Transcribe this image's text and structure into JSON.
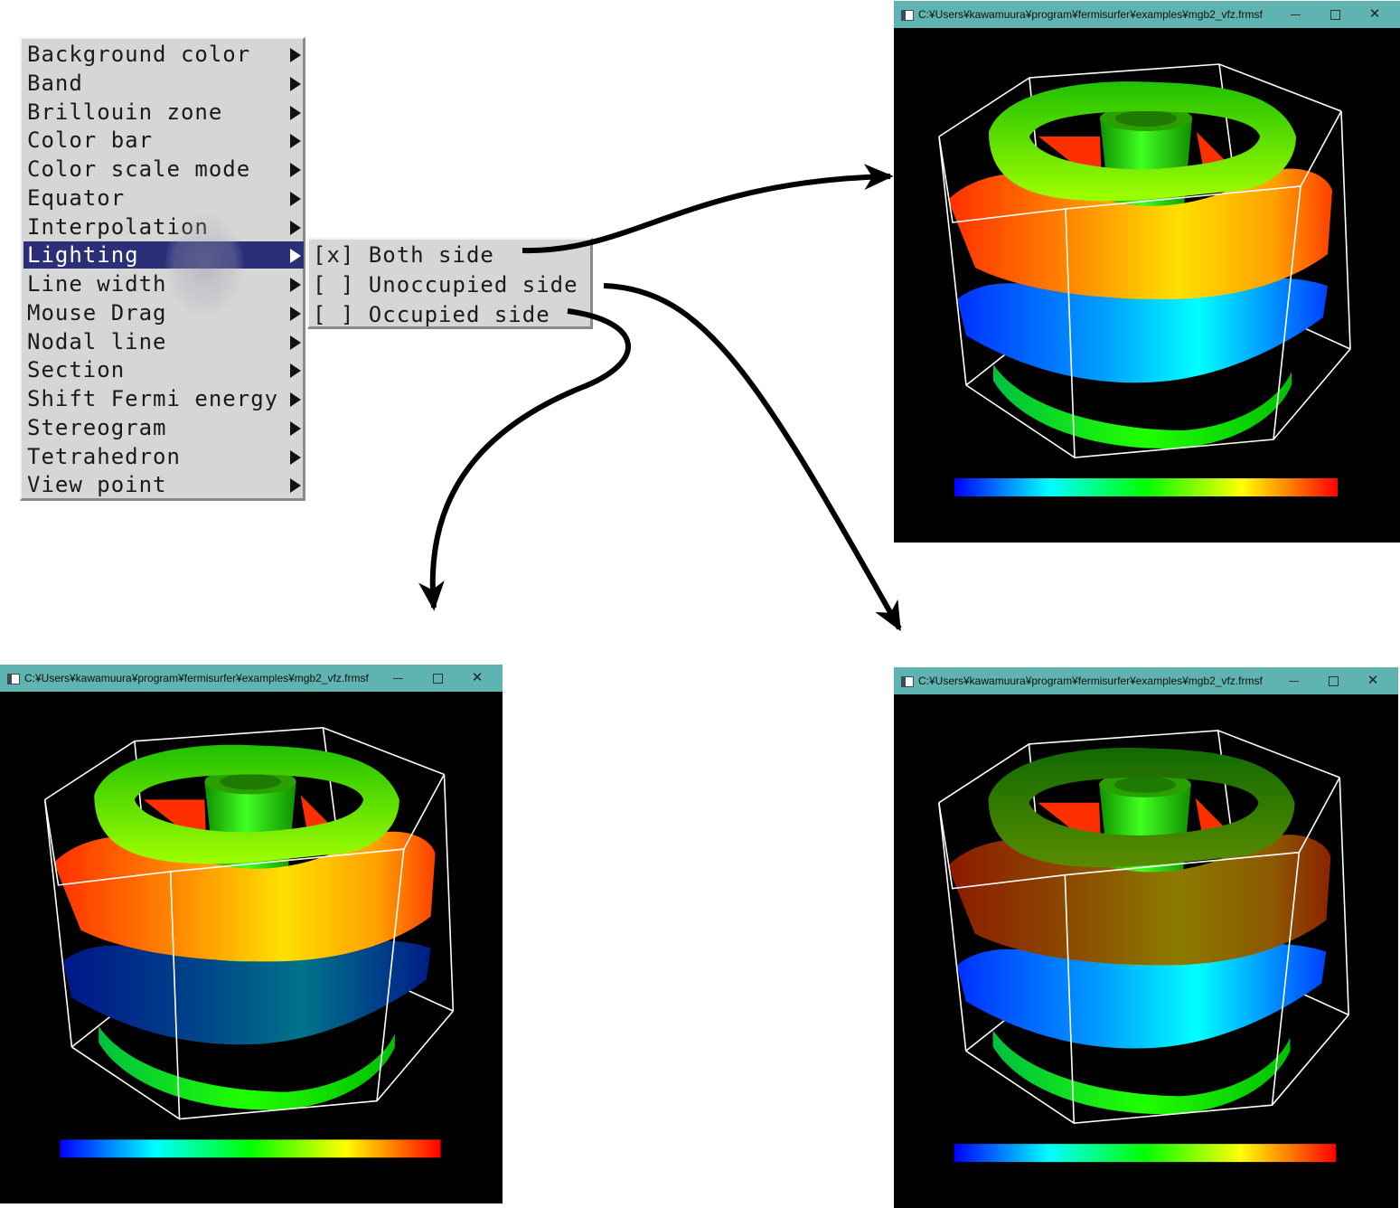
{
  "menu": {
    "items": [
      {
        "label": "Background color",
        "name": "menu-item-background-color"
      },
      {
        "label": "Band",
        "name": "menu-item-band"
      },
      {
        "label": "Brillouin zone",
        "name": "menu-item-brillouin-zone"
      },
      {
        "label": "Color bar",
        "name": "menu-item-color-bar"
      },
      {
        "label": "Color scale mode",
        "name": "menu-item-color-scale-mode"
      },
      {
        "label": "Equator",
        "name": "menu-item-equator"
      },
      {
        "label": "Interpolation",
        "name": "menu-item-interpolation"
      },
      {
        "label": "Lighting",
        "name": "menu-item-lighting",
        "active": true
      },
      {
        "label": "Line width",
        "name": "menu-item-line-width"
      },
      {
        "label": "Mouse Drag",
        "name": "menu-item-mouse-drag"
      },
      {
        "label": "Nodal line",
        "name": "menu-item-nodal-line"
      },
      {
        "label": "Section",
        "name": "menu-item-section"
      },
      {
        "label": "Shift Fermi energy",
        "name": "menu-item-shift-fermi-energy"
      },
      {
        "label": "Stereogram",
        "name": "menu-item-stereogram"
      },
      {
        "label": "Tetrahedron",
        "name": "menu-item-tetrahedron"
      },
      {
        "label": "View point",
        "name": "menu-item-view-point"
      }
    ]
  },
  "submenu": {
    "items": [
      {
        "label": "[x] Both side",
        "name": "submenu-item-both-side",
        "checked": true
      },
      {
        "label": "[ ] Unoccupied side",
        "name": "submenu-item-unoccupied-side",
        "checked": false
      },
      {
        "label": "[ ] Occupied side",
        "name": "submenu-item-occupied-side",
        "checked": false
      }
    ]
  },
  "windows": [
    {
      "name": "window-both-side",
      "title": "C:¥Users¥kawamuura¥program¥fermisurfer¥examples¥mgb2_vfz.frmsf",
      "minimize": "–",
      "close": "✕"
    },
    {
      "name": "window-occupied-side",
      "title": "C:¥Users¥kawamuura¥program¥fermisurfer¥examples¥mgb2_vfz.frmsf",
      "minimize": "–",
      "close": "✕"
    },
    {
      "name": "window-unoccupied-side",
      "title": "C:¥Users¥kawamuura¥program¥fermisurfer¥examples¥mgb2_vfz.frmsf",
      "minimize": "–",
      "close": "✕"
    }
  ],
  "colors": {
    "titlebar": "#5fb3b0",
    "menu_bg": "#d6d6d6",
    "menu_highlight": "#2b2f78",
    "colorbar": [
      "#0000ff",
      "#0080ff",
      "#00ffff",
      "#00ff80",
      "#00ff00",
      "#80ff00",
      "#ffff00",
      "#ff8000",
      "#ff0000"
    ]
  }
}
